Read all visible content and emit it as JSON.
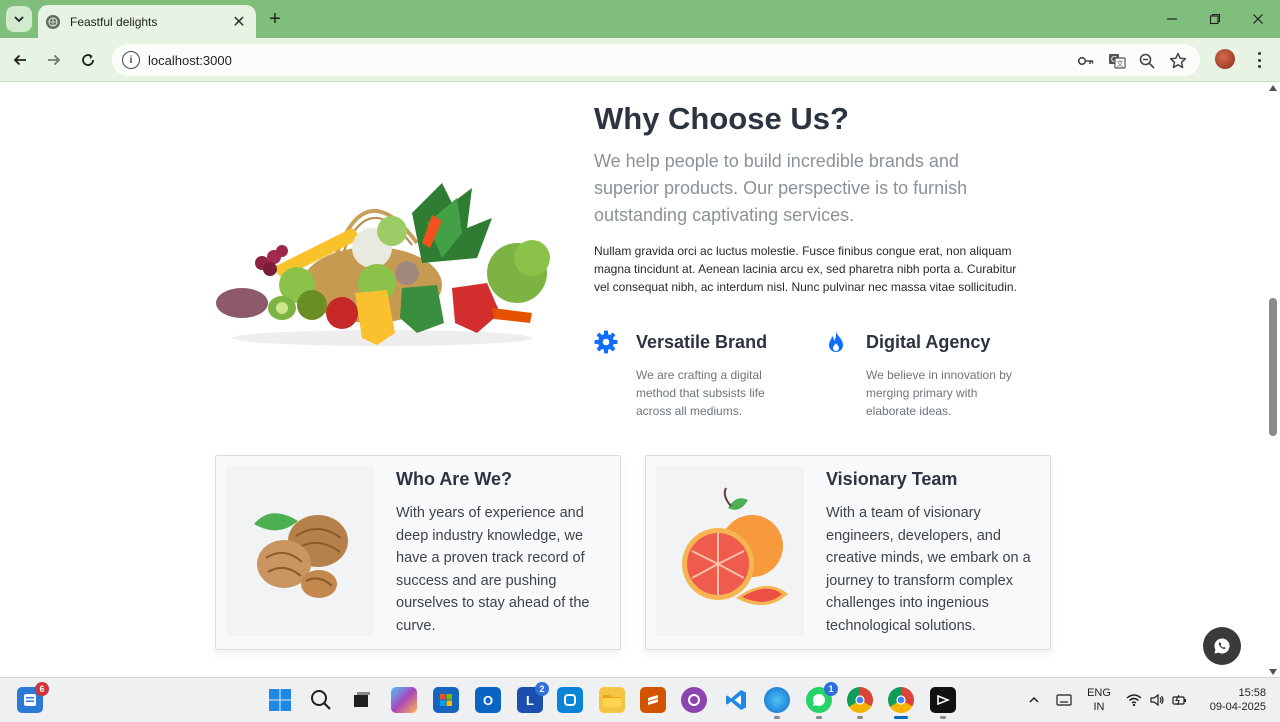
{
  "browser": {
    "tab_title": "Feastful delights",
    "url": "localhost:3000"
  },
  "section": {
    "title": "Why Choose Us?",
    "lead": "We help people to build incredible brands and superior products. Our perspective is to furnish outstanding captivating services.",
    "body": "Nullam gravida orci ac luctus molestie. Fusce finibus congue erat, non aliquam magna tincidunt at. Aenean lacinia arcu ex, sed pharetra nibh porta a. Curabitur vel consequat nibh, ac interdum nisl. Nunc pulvinar nec massa vitae sollicitudin."
  },
  "features": [
    {
      "icon": "gear-icon",
      "title": "Versatile Brand",
      "text": "We are crafting a digital method that subsists life across all mediums."
    },
    {
      "icon": "flame-icon",
      "title": "Digital Agency",
      "text": "We believe in innovation by merging primary with elaborate ideas."
    }
  ],
  "cards": [
    {
      "image": "walnut-image",
      "title": "Who Are We?",
      "text": "With years of experience and deep industry knowledge, we have a proven track record of success and are pushing ourselves to stay ahead of the curve."
    },
    {
      "image": "grapefruit-image",
      "title": "Visionary Team",
      "text": "With a team of visionary engineers, developers, and creative minds, we embark on a journey to transform complex challenges into ingenious technological solutions."
    }
  ],
  "colors": {
    "chrome_green": "#7fbf7b",
    "accent_blue": "#0d6efd"
  },
  "taskbar": {
    "widgets_badge": "6",
    "l_app_badge": "2",
    "whatsapp_badge": "1",
    "language_line1": "ENG",
    "language_line2": "IN",
    "time": "15:58",
    "date": "09-04-2025"
  }
}
